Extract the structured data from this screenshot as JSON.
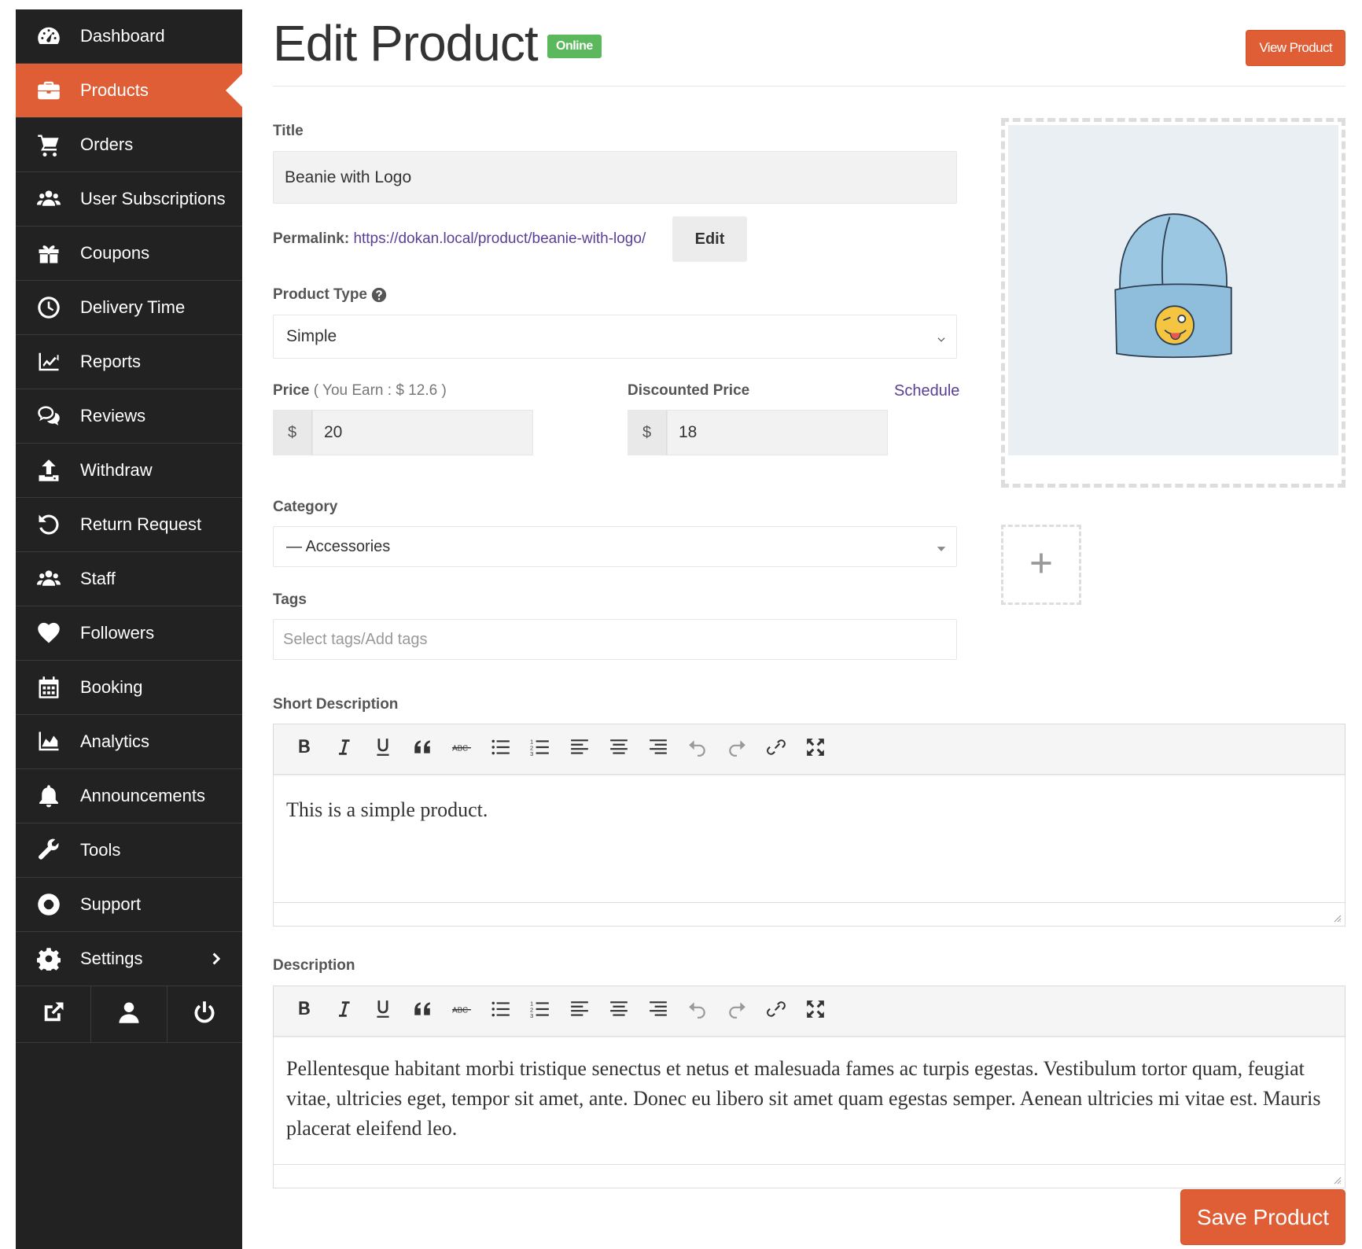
{
  "sidebar": {
    "items": [
      {
        "label": "Dashboard",
        "icon": "dashboard-icon"
      },
      {
        "label": "Products",
        "icon": "briefcase-icon",
        "active": true
      },
      {
        "label": "Orders",
        "icon": "cart-icon"
      },
      {
        "label": "User Subscriptions",
        "icon": "users-icon"
      },
      {
        "label": "Coupons",
        "icon": "gift-icon"
      },
      {
        "label": "Delivery Time",
        "icon": "clock-icon"
      },
      {
        "label": "Reports",
        "icon": "line-chart-icon"
      },
      {
        "label": "Reviews",
        "icon": "comments-icon"
      },
      {
        "label": "Withdraw",
        "icon": "upload-icon"
      },
      {
        "label": "Return Request",
        "icon": "undo-icon"
      },
      {
        "label": "Staff",
        "icon": "users-icon"
      },
      {
        "label": "Followers",
        "icon": "heart-icon"
      },
      {
        "label": "Booking",
        "icon": "calendar-icon"
      },
      {
        "label": "Analytics",
        "icon": "area-chart-icon"
      },
      {
        "label": "Announcements",
        "icon": "bell-icon"
      },
      {
        "label": "Tools",
        "icon": "wrench-icon"
      },
      {
        "label": "Support",
        "icon": "lifebuoy-icon"
      },
      {
        "label": "Settings",
        "icon": "gear-icon"
      }
    ],
    "footer": [
      "external-link-icon",
      "user-icon",
      "power-icon"
    ]
  },
  "header": {
    "title": "Edit Product",
    "status": "Online",
    "view_button": "View Product"
  },
  "form": {
    "title_label": "Title",
    "title_value": "Beanie with Logo",
    "permalink_label": "Permalink:",
    "permalink_url": "https://dokan.local/product/beanie-with-logo/",
    "permalink_edit": "Edit",
    "product_type_label": "Product Type",
    "product_type_value": "Simple",
    "price_label": "Price",
    "price_earn": "( You Earn : $ 12.6 )",
    "currency": "$",
    "price_value": "20",
    "discount_label": "Discounted Price",
    "schedule_link": "Schedule",
    "discount_value": "18",
    "category_label": "Category",
    "category_value": "— Accessories",
    "tags_label": "Tags",
    "tags_placeholder": "Select tags/Add tags",
    "short_desc_label": "Short Description",
    "short_desc_text": "This is a simple product.",
    "desc_label": "Description",
    "desc_text": "Pellentesque habitant morbi tristique senectus et netus et malesuada fames ac turpis egestas. Vestibulum tortor quam, feugiat vitae, ultricies eget, tempor sit amet, ante. Donec eu libero sit amet quam egestas semper. Aenean ultricies mi vitae est. Mauris placerat eleifend leo.",
    "save_button": "Save Product"
  },
  "colors": {
    "accent": "#e05e36",
    "sidebar_bg": "#222222",
    "online": "#5cb85c",
    "link": "#5b3e96"
  }
}
